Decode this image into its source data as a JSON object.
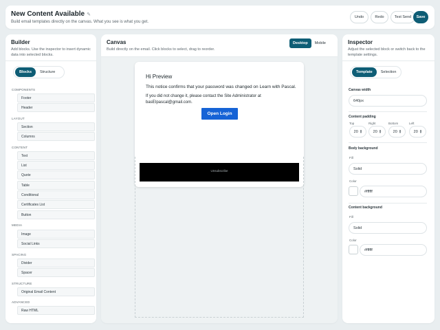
{
  "header": {
    "title": "New Content Available",
    "subtitle": "Build email templates directly on the canvas. What you see is what you get.",
    "buttons": {
      "undo": "Undo",
      "redo": "Redo",
      "test_send": "Test Send",
      "save": "Save"
    }
  },
  "builder": {
    "title": "Builder",
    "desc_line1": "Add blocks. Use the inspector to insert dynamic",
    "desc_line2": "data into selected blocks.",
    "tabs": {
      "blocks": "Blocks",
      "structure": "Structure"
    },
    "groups": {
      "components": "COMPONENTS",
      "layout": "LAYOUT",
      "content": "CONTENT",
      "media": "MEDIA",
      "spacing": "SPACING",
      "structure": "STRUCTURE",
      "advanced": "ADVANCED"
    },
    "items": {
      "footer": "Footer",
      "header": "Header",
      "section": "Section",
      "columns": "Columns",
      "text": "Text",
      "list": "List",
      "quote": "Quote",
      "table": "Table",
      "conditional": "Conditional",
      "certificates_list": "Certificates List",
      "button": "Button",
      "image": "Image",
      "social_links": "Social Links",
      "divider": "Divider",
      "spacer": "Spacer",
      "original_email_content": "Original Email Content",
      "raw_html": "Raw HTML"
    }
  },
  "canvas": {
    "title": "Canvas",
    "desc": "Build directly on the email. Click blocks to select, drag to reorder.",
    "view_tabs": {
      "desktop": "Desktop",
      "mobile": "Mobile"
    },
    "email": {
      "greeting": "Hi Preview",
      "line1": "This notice confirms that your password was changed on Learn with Pascal.",
      "line2": "If you did not change it, please contact the Site Administrator at basEIpascal@gmail.com.",
      "button": "Open Login",
      "unsubscribe": "Unsubscribe"
    }
  },
  "inspector": {
    "title": "Inspector",
    "desc_line1": "Adjust the selected block or switch back to the",
    "desc_line2": "template settings.",
    "tabs": {
      "template": "Template",
      "selection": "Selection"
    },
    "canvas_width": {
      "label": "Canvas width",
      "value": "640px"
    },
    "content_padding": {
      "label": "Content padding",
      "top_label": "Top",
      "right_label": "Right",
      "bottom_label": "Bottom",
      "left_label": "Left",
      "top": "20",
      "right": "20",
      "bottom": "20",
      "left": "20"
    },
    "body_background": {
      "label": "Body background",
      "fill_label": "Fill",
      "fill_value": "Solid",
      "color_label": "Color",
      "color_value": "#ffffff"
    },
    "content_background": {
      "label": "Content background",
      "fill_label": "Fill",
      "fill_value": "Solid",
      "color_label": "Color",
      "color_value": "#ffffff"
    }
  },
  "colors": {
    "accent": "#0e5d75",
    "email_button": "#1663d6",
    "footer": "#000000"
  }
}
